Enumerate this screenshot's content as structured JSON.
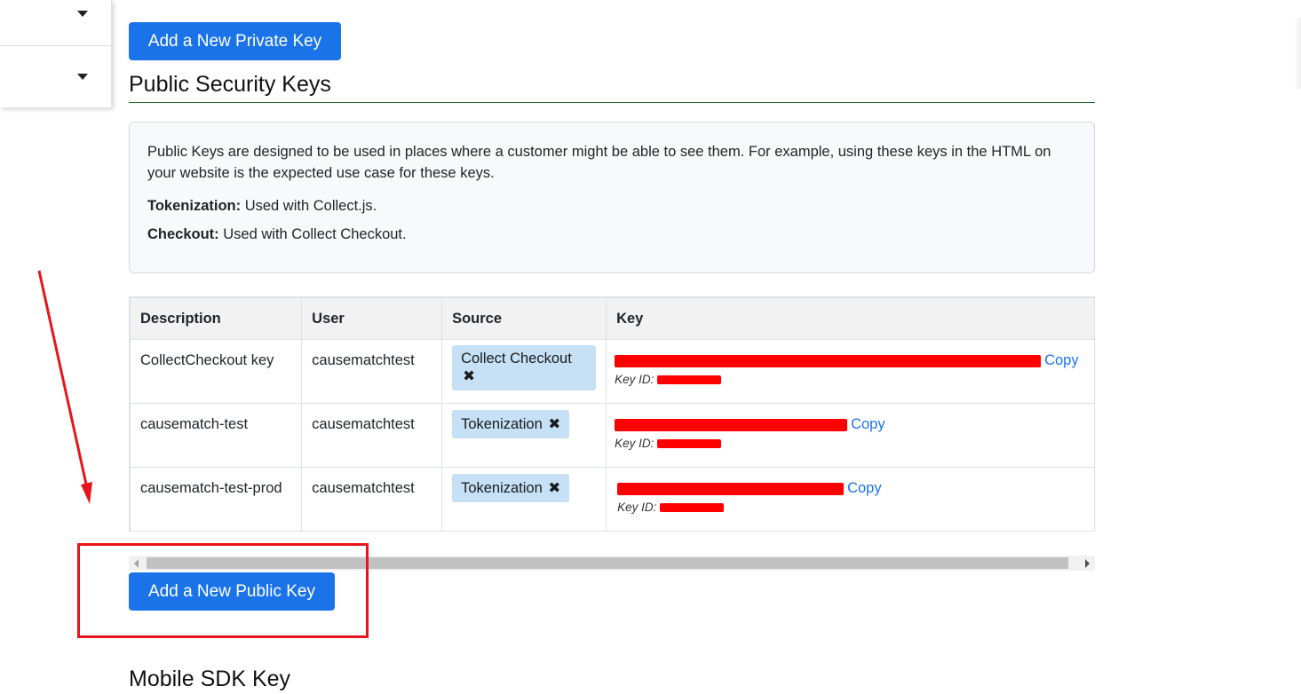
{
  "buttons": {
    "add_private_key": "Add a New Private Key",
    "add_public_key": "Add a New Public Key"
  },
  "section": {
    "title": "Public Security Keys",
    "next_title": "Mobile SDK Key"
  },
  "info": {
    "intro": "Public Keys are designed to be used in places where a customer might be able to see them. For example, using these keys in the HTML on your website is the expected use case for these keys.",
    "tokenization_label": "Tokenization:",
    "tokenization_text": " Used with Collect.js.",
    "checkout_label": "Checkout:",
    "checkout_text": " Used with Collect Checkout."
  },
  "table": {
    "headers": [
      "Description",
      "User",
      "Source",
      "Key"
    ],
    "rows": [
      {
        "description": "CollectCheckout key",
        "user": "causematchtest",
        "source": "Collect Checkout",
        "copy": "Copy",
        "key_id_label": "Key ID:"
      },
      {
        "description": "causematch-test",
        "user": "causematchtest",
        "source": "Tokenization",
        "copy": "Copy",
        "key_id_label": "Key ID:"
      },
      {
        "description": "causematch-test-prod",
        "user": "causematchtest",
        "source": "Tokenization",
        "copy": "Copy",
        "key_id_label": "Key ID:"
      }
    ]
  },
  "icons": {
    "dropdown": "caret-down-icon",
    "remove": "close-icon"
  },
  "colors": {
    "primary": "#1a73e8",
    "badge": "#c6e0f5",
    "redaction": "#ff0000",
    "annotation": "#e8141b"
  }
}
